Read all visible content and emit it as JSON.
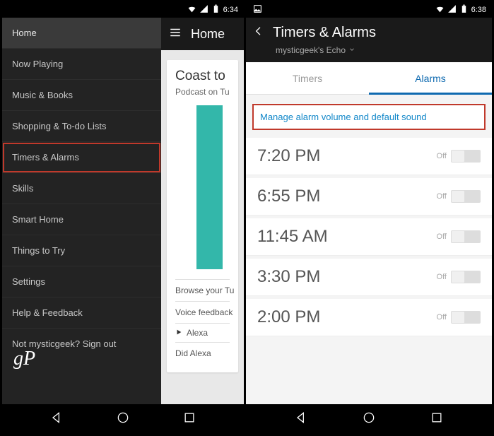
{
  "left": {
    "statusbar": {
      "time": "6:34"
    },
    "header": {
      "title": "Home"
    },
    "drawer": {
      "items": [
        {
          "label": "Home",
          "selected": true
        },
        {
          "label": "Now Playing"
        },
        {
          "label": "Music & Books"
        },
        {
          "label": "Shopping & To-do Lists"
        },
        {
          "label": "Timers & Alarms",
          "highlighted": true
        },
        {
          "label": "Skills"
        },
        {
          "label": "Smart Home"
        },
        {
          "label": "Things to Try"
        },
        {
          "label": "Settings"
        },
        {
          "label": "Help & Feedback"
        }
      ],
      "signout": "Not mysticgeek? Sign out"
    },
    "card": {
      "title": "Coast to",
      "sub": "Podcast on Tu",
      "browse": "Browse your Tu",
      "voice_feedback": "Voice feedback",
      "alexa_line": "Alexa",
      "did_alexa": "Did Alexa"
    },
    "watermark": "gP"
  },
  "right": {
    "statusbar": {
      "time": "6:38"
    },
    "header": {
      "title": "Timers & Alarms",
      "subtitle": "mysticgeek's Echo"
    },
    "tabs": [
      {
        "label": "Timers",
        "active": false
      },
      {
        "label": "Alarms",
        "active": true
      }
    ],
    "manage_link": "Manage alarm volume and default sound",
    "off_label": "Off",
    "alarms": [
      {
        "time": "7:20 PM"
      },
      {
        "time": "6:55 PM"
      },
      {
        "time": "11:45 AM"
      },
      {
        "time": "3:30 PM"
      },
      {
        "time": "2:00 PM"
      }
    ]
  }
}
